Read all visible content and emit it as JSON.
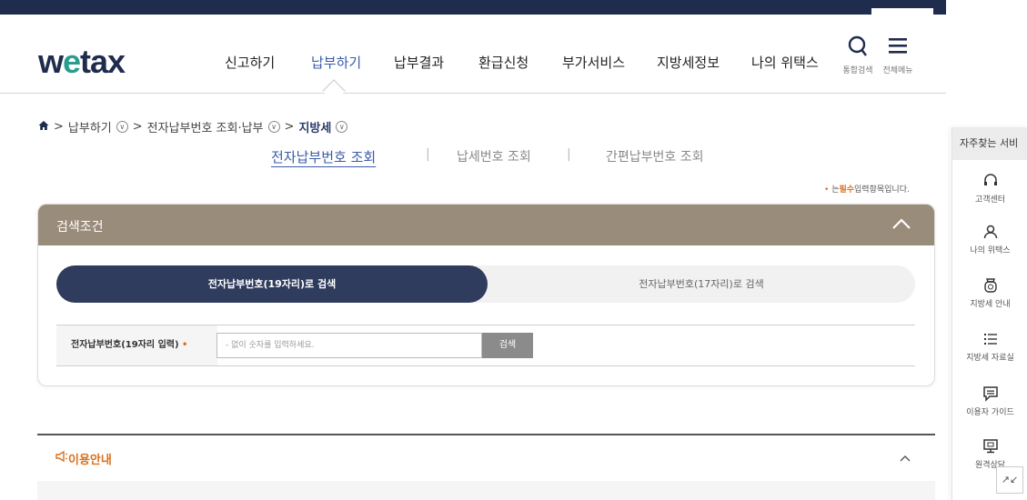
{
  "logo": {
    "prefix": "w",
    "mid": "e",
    "suffix": "tax"
  },
  "nav": [
    {
      "label": "신고하기",
      "active": false
    },
    {
      "label": "납부하기",
      "active": true
    },
    {
      "label": "납부결과",
      "active": false
    },
    {
      "label": "환급신청",
      "active": false
    },
    {
      "label": "부가서비스",
      "active": false
    },
    {
      "label": "지방세정보",
      "active": false
    },
    {
      "label": "나의 위택스",
      "active": false
    }
  ],
  "header_tools": {
    "search_label": "통합검색",
    "menu_label": "전체메뉴"
  },
  "breadcrumb": {
    "level1": "납부하기",
    "level2": "전자납부번호 조회·납부",
    "level3": "지방세"
  },
  "subtabs": [
    "전자납부번호 조회",
    "납세번호 조회",
    "간편납부번호 조회"
  ],
  "required_note": {
    "dot": "•",
    "prefix": "는",
    "emph": "필수",
    "suffix": "입력항목입니다."
  },
  "search_panel": {
    "title": "검색조건",
    "toggle": {
      "active": "전자납부번호(19자리)로 검색",
      "inactive": "전자납부번호(17자리)로 검색"
    },
    "field_label": "전자납부번호(19자리 입력)",
    "required_dot": "•",
    "placeholder": "- 없이 숫자를 입력하세요.",
    "button": "검색"
  },
  "notice": {
    "title": "이용안내"
  },
  "quick_menu": {
    "title": "자주찾는 서비",
    "items": [
      "고객센터",
      "나의 위택스",
      "지방세 안내",
      "지방세 자료실",
      "이용자 가이드",
      "원격상담"
    ]
  },
  "colors": {
    "navy": "#2f3c5e",
    "accent": "#3a5ba9",
    "panel_head": "#9a8c7b",
    "orange": "#d9711d"
  }
}
